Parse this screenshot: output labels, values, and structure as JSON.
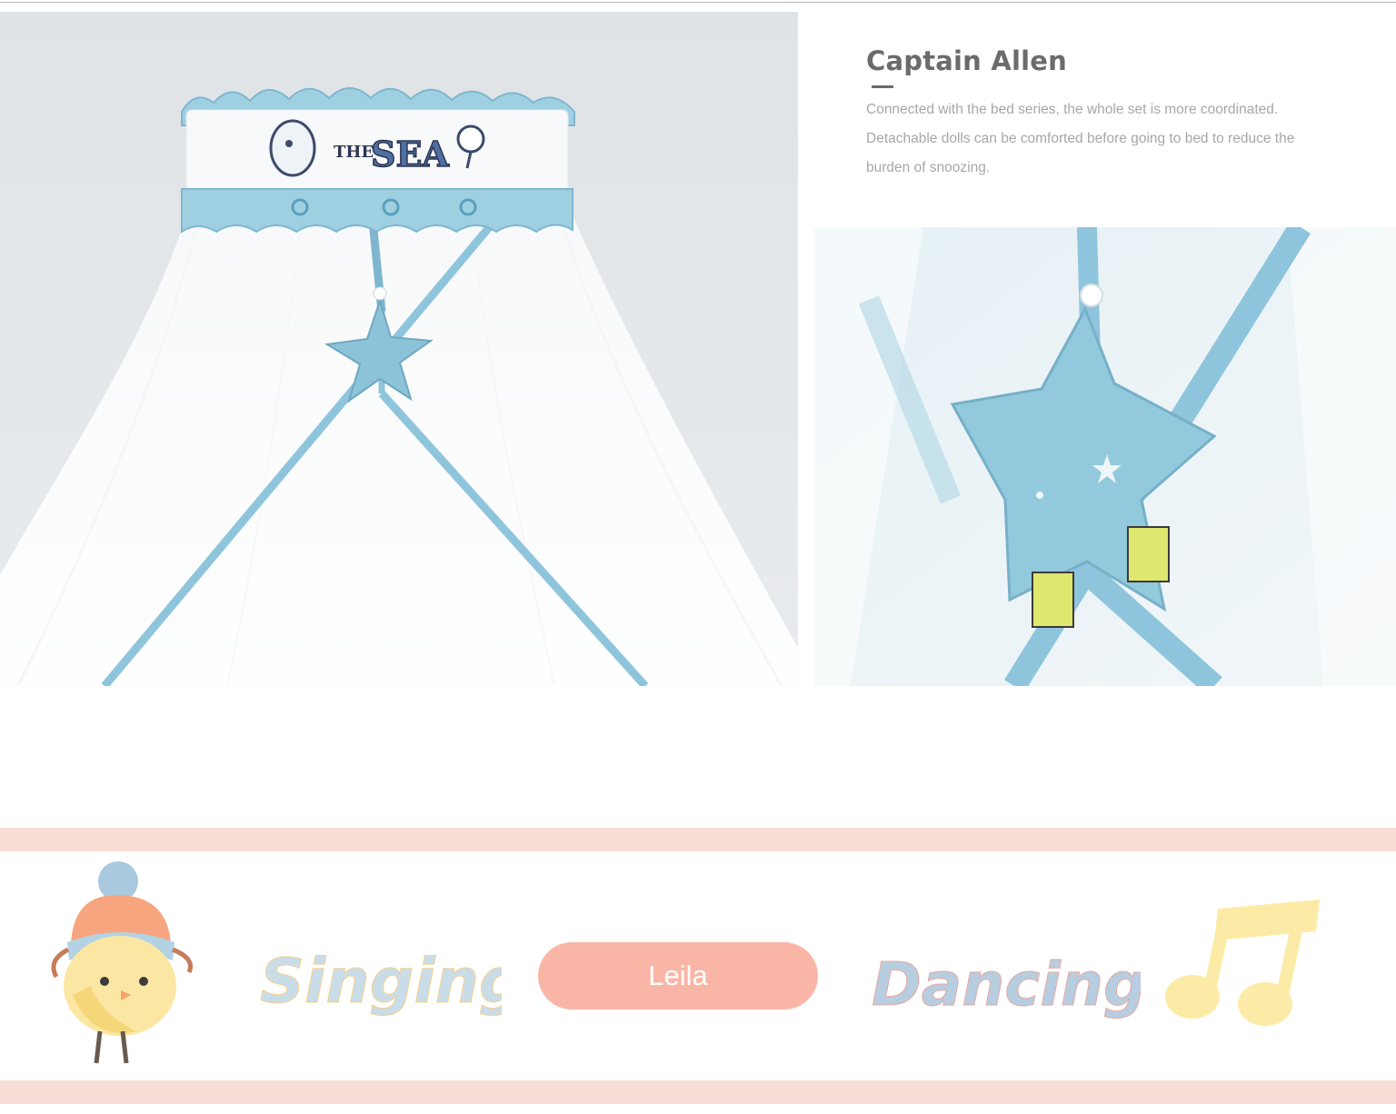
{
  "info": {
    "title": "Captain Allen",
    "description": "Connected with the bed series, the whole set is more coordinated. Detachable dolls can be comforted before going to bed to reduce the burden of snoozing."
  },
  "canopy_band_text": {
    "the": "THE",
    "sea": "SEA"
  },
  "banner": {
    "word_left": "Singing",
    "name": "Leila",
    "word_right": "Dancing"
  },
  "colors": {
    "band_pink": "#f8ddd6",
    "pill_salmon": "#f9b6a6",
    "fabric_blue": "#8ec5dc",
    "title_gray": "#6b6b6b",
    "text_gray": "#a7a7a7"
  },
  "icons": {
    "chick": "chick-with-hat-icon",
    "note": "music-note-icon",
    "star": "star-doll-icon"
  }
}
